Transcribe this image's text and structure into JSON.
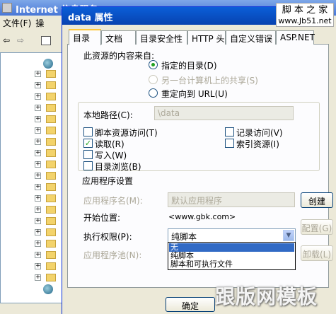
{
  "background_window": {
    "title": "Internet 信息服务",
    "menu": [
      "文件(F)",
      "操"
    ]
  },
  "dialog": {
    "title": "data 属性"
  },
  "watermark_top": {
    "line1": "脚 本 之 家",
    "line2": "www.Jb51.net"
  },
  "tabs": [
    "目录",
    "文档",
    "目录安全性",
    "HTTP 头",
    "自定义错误",
    "ASP.NET"
  ],
  "content_source": {
    "heading": "此资源的内容来自:",
    "options": [
      "指定的目录(D)",
      "另一台计算机上的共享(S)",
      "重定向到 URL(U)"
    ],
    "selected": 0
  },
  "local_path": {
    "label": "本地路径(C):",
    "value": "\\data"
  },
  "checkboxes_left": [
    {
      "label": "脚本资源访问(T)",
      "checked": false
    },
    {
      "label": "读取(R)",
      "checked": true
    },
    {
      "label": "写入(W)",
      "checked": false
    },
    {
      "label": "目录浏览(B)",
      "checked": false
    }
  ],
  "checkboxes_right": [
    {
      "label": "记录访问(V)",
      "checked": false
    },
    {
      "label": "索引资源(I)",
      "checked": false
    }
  ],
  "app_settings": {
    "heading": "应用程序设置",
    "app_name_label": "应用程序名(M):",
    "app_name_value": "默认应用程序",
    "create_button": "创建",
    "start_label": "开始位置:",
    "start_value": "<www.gbk.com>",
    "config_button": "配置(G)",
    "exec_label": "执行权限(P):",
    "exec_value": "纯脚本",
    "pool_label": "应用程序池(N):",
    "unload_button": "卸载(L)"
  },
  "exec_options": [
    "无",
    "纯脚本",
    "脚本和可执行文件"
  ],
  "ok_button": "确定",
  "watermark_bottom": "跟版网模板"
}
